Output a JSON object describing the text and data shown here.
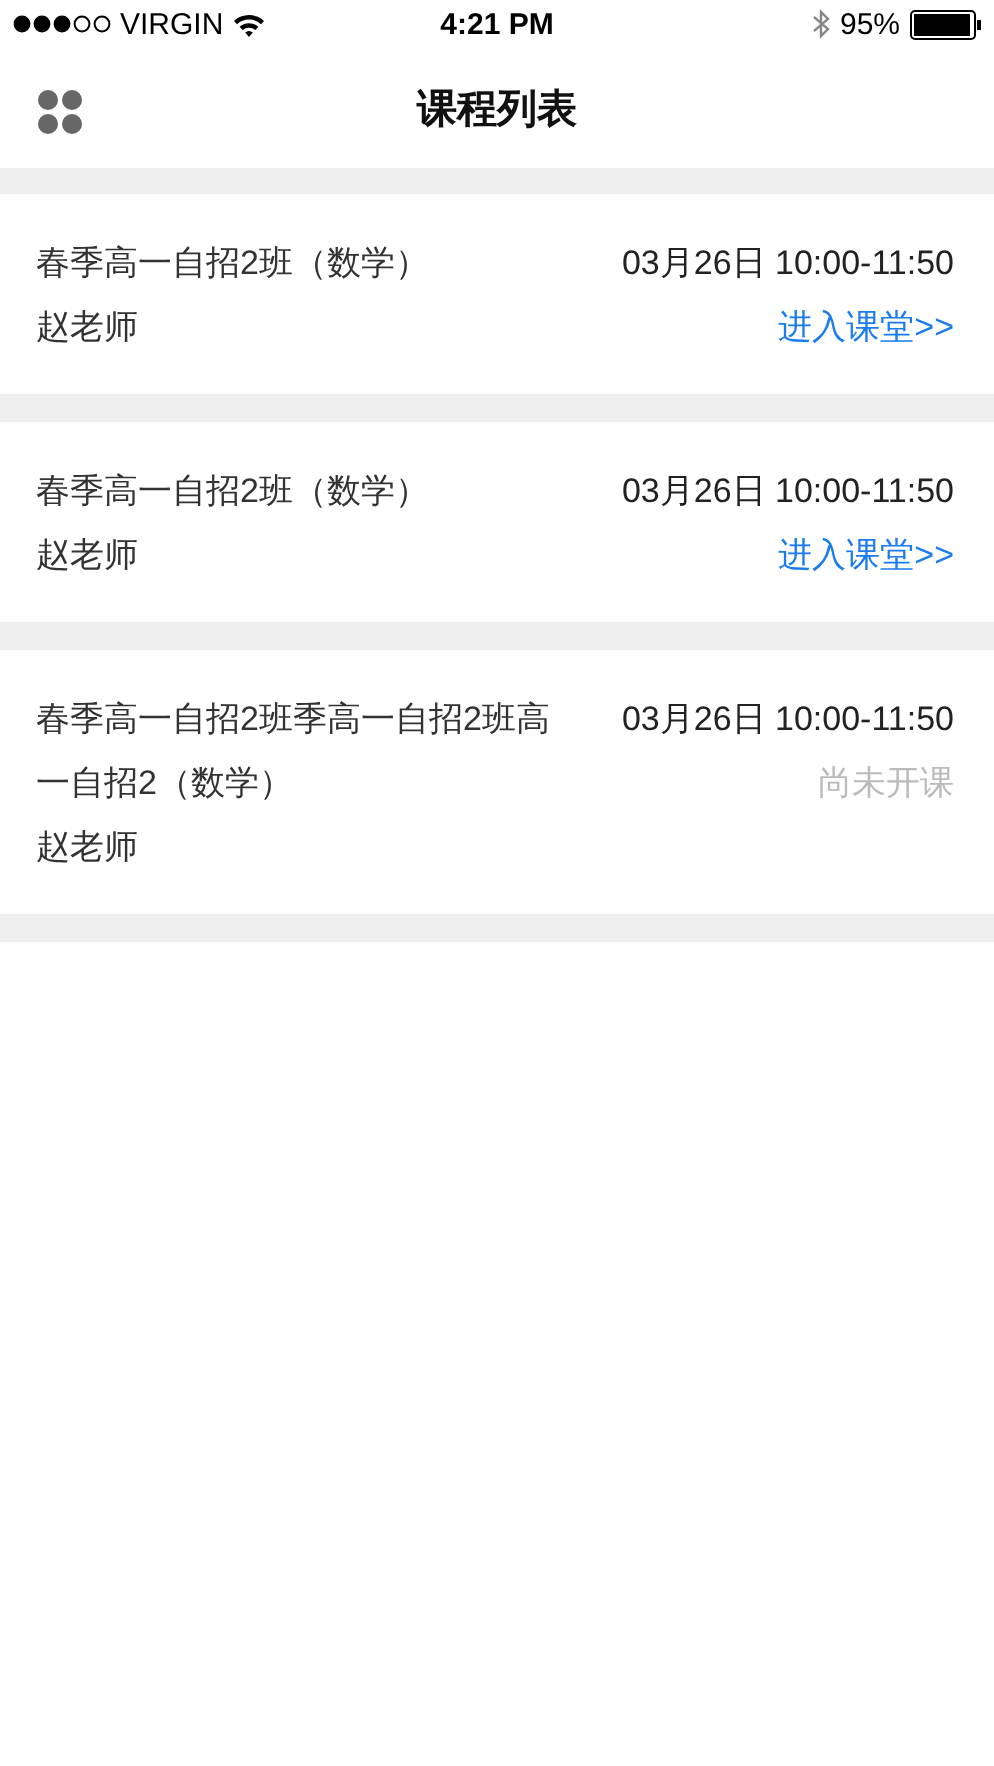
{
  "status_bar": {
    "carrier": "VIRGIN",
    "time": "4:21 PM",
    "battery": "95%"
  },
  "nav": {
    "title": "课程列表"
  },
  "courses": [
    {
      "title": "春季高一自招2班（数学）",
      "teacher": "赵老师",
      "time": "03月26日 10:00-11:50",
      "action": {
        "kind": "link",
        "label": "进入课堂>>"
      }
    },
    {
      "title": "春季高一自招2班（数学）",
      "teacher": "赵老师",
      "time": "03月26日 10:00-11:50",
      "action": {
        "kind": "link",
        "label": "进入课堂>>"
      }
    },
    {
      "title": "春季高一自招2班季高一自招2班高一自招2（数学）",
      "teacher": "赵老师",
      "time": "03月26日 10:00-11:50",
      "action": {
        "kind": "status",
        "label": "尚未开课"
      }
    }
  ]
}
